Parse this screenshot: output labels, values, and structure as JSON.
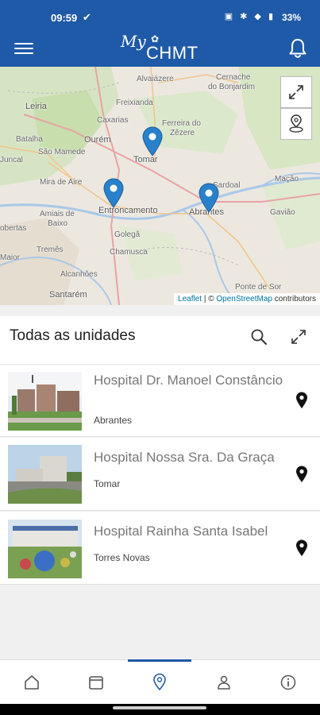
{
  "status_bar": {
    "time": "09:59",
    "indicators": "▣ ✱ ◆ ▮",
    "battery": "33%"
  },
  "app_bar": {
    "logo_my": "My",
    "logo_name": "CHMT",
    "menu_icon": "hamburger-icon",
    "bell_icon": "bell-icon"
  },
  "map": {
    "labels": {
      "alvaiazere": "Alvaiázere",
      "cernache": "Cernache",
      "do_bonjardim": "do Bonjardim",
      "leiria": "Leiria",
      "freixianda": "Freixianda",
      "caxarias": "Caxarias",
      "ferreira": "Ferreira do",
      "zezere": "Zêzere",
      "batalha": "Batalha",
      "ourem": "Ourém",
      "sao_mamede": "São Mamede",
      "tomar": "Tomar",
      "juncal": "Juncal",
      "mira_de_aire": "Mira de Aire",
      "sardoal": "Sardoal",
      "macao": "Mação",
      "amiais_de": "Amiais de",
      "baixo": "Baixo",
      "entroncamento": "Entroncamento",
      "abrantes": "Abrantes",
      "gaviao": "Gavião",
      "obertas": "obertas",
      "golega": "Golegã",
      "tremes": "Tremês",
      "chamusca": "Chamusca",
      "maior": "Maior",
      "alcanhoes": "Alcanhões",
      "santarem": "Santarém",
      "ponte_de_sor": "Ponte de Sor"
    },
    "attribution": {
      "leaflet": "Leaflet",
      "separator": " | © ",
      "osm": "OpenStreetMap",
      "contributors": " contributors"
    }
  },
  "list": {
    "title": "Todas as unidades",
    "items": [
      {
        "name": "Hospital Dr. Manoel Constâncio",
        "city": "Abrantes"
      },
      {
        "name": "Hospital Nossa Sra. Da Graça",
        "city": "Tomar"
      },
      {
        "name": "Hospital Rainha Santa Isabel",
        "city": "Torres Novas"
      }
    ]
  },
  "bottom_nav": {
    "items": [
      "home-icon",
      "calendar-icon",
      "location-icon",
      "profile-icon",
      "info-icon"
    ],
    "active": "location-icon"
  },
  "colors": {
    "brand": "#1f5aa8",
    "pin": "#2a81cb",
    "link": "#0078a8"
  }
}
